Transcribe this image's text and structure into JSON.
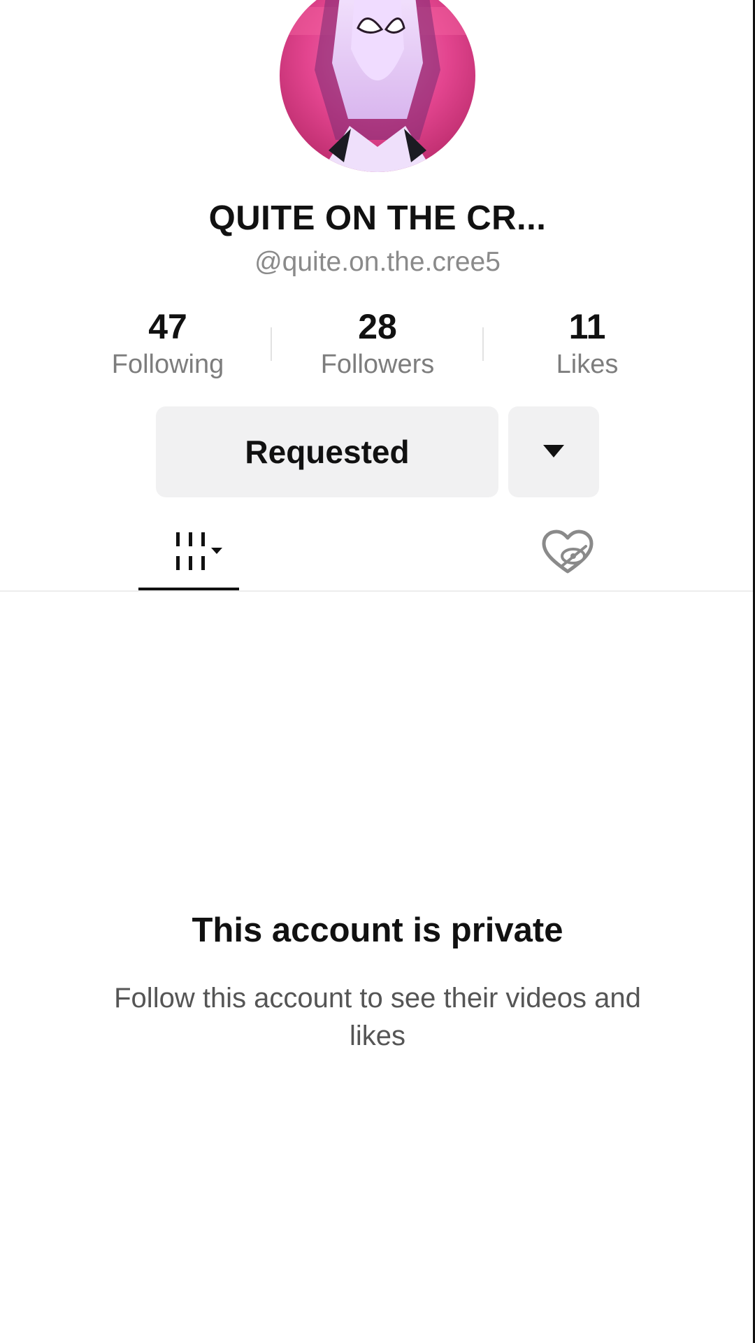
{
  "profile": {
    "display_name": "QUITE ON THE CR...",
    "username": "@quite.on.the.cree5"
  },
  "stats": {
    "following": {
      "value": "47",
      "label": "Following"
    },
    "followers": {
      "value": "28",
      "label": "Followers"
    },
    "likes": {
      "value": "11",
      "label": "Likes"
    }
  },
  "actions": {
    "requested_label": "Requested",
    "more_icon": "caret-down-icon"
  },
  "tabs": [
    {
      "name": "videos",
      "icon": "grid-icon",
      "selected": true
    },
    {
      "name": "liked",
      "icon": "hidden-heart-icon",
      "selected": false
    }
  ],
  "private_notice": {
    "title": "This account is private",
    "description": "Follow this account to see their videos and likes"
  },
  "colors": {
    "text_primary": "#111111",
    "text_secondary": "#8a8a8a",
    "button_bg": "#f1f1f2",
    "divider": "#ededed"
  }
}
